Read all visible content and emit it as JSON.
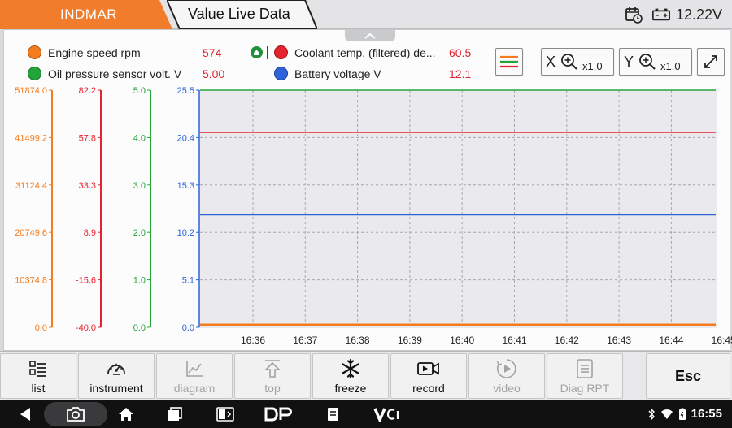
{
  "titlebar": {
    "brand": "INDMAR",
    "page_title": "Value Live Data",
    "voltage": "12.22V",
    "colors": {
      "brand_tab": "#f07c2c"
    }
  },
  "legend": [
    {
      "label": "Engine speed  rpm",
      "value": "574",
      "color": "#f47c1f"
    },
    {
      "label": "Oil pressure sensor volt.  V",
      "value": "5.00",
      "color": "#23a43a"
    },
    {
      "label": "Coolant temp. (filtered)   de...",
      "value": "60.5",
      "color": "#e5232e"
    },
    {
      "label": "Battery voltage  V",
      "value": "12.1",
      "color": "#2f63d9"
    }
  ],
  "zoom": {
    "x_label": "X",
    "x_value": "x1.0",
    "y_label": "Y",
    "y_value": "x1.0"
  },
  "chart_data": {
    "type": "line",
    "x": [
      "16:36",
      "16:37",
      "16:38",
      "16:39",
      "16:40",
      "16:41",
      "16:42",
      "16:43",
      "16:44",
      "16:45"
    ],
    "grid": true,
    "axes": [
      {
        "series": "Engine speed",
        "color": "#f47c1f",
        "ticks": [
          "51874.0",
          "41499.2",
          "31124.4",
          "20749.6",
          "10374.8",
          "0.0"
        ],
        "ylim": [
          0,
          51874
        ]
      },
      {
        "series": "Coolant temp.",
        "color": "#e5232e",
        "ticks": [
          "82.2",
          "57.8",
          "33.3",
          "8.9",
          "-15.6",
          "-40.0"
        ],
        "ylim": [
          -40,
          82.2
        ]
      },
      {
        "series": "Oil pressure",
        "color": "#23a43a",
        "ticks": [
          "5.0",
          "4.0",
          "3.0",
          "2.0",
          "1.0",
          "0.0"
        ],
        "ylim": [
          0,
          5
        ]
      },
      {
        "series": "Battery voltage",
        "color": "#2f63d9",
        "ticks": [
          "25.5",
          "20.4",
          "15.3",
          "10.2",
          "5.1",
          "0.0"
        ],
        "ylim": [
          0,
          25.5
        ]
      }
    ],
    "series": [
      {
        "name": "Engine speed",
        "axis": 0,
        "values": [
          574,
          574,
          574,
          574,
          574,
          574,
          574,
          574,
          574,
          574,
          574
        ]
      },
      {
        "name": "Coolant temp.",
        "axis": 1,
        "values": [
          60.5,
          60.5,
          60.5,
          60.5,
          60.5,
          60.5,
          60.5,
          60.5,
          60.5,
          60.5,
          60.5
        ]
      },
      {
        "name": "Oil pressure",
        "axis": 2,
        "values": [
          5.0,
          5.0,
          5.0,
          5.0,
          5.0,
          5.0,
          5.0,
          5.0,
          5.0,
          5.0,
          5.0
        ]
      },
      {
        "name": "Battery voltage",
        "axis": 3,
        "values": [
          12.1,
          12.1,
          12.1,
          12.1,
          12.1,
          12.1,
          12.1,
          12.1,
          12.1,
          12.1,
          12.1
        ]
      }
    ]
  },
  "toolbar": [
    {
      "key": "list",
      "label": "list",
      "icon": "list-icon",
      "enabled": true
    },
    {
      "key": "instrument",
      "label": "instrument",
      "icon": "gauge-icon",
      "enabled": true
    },
    {
      "key": "diagram",
      "label": "diagram",
      "icon": "line-chart-icon",
      "enabled": false
    },
    {
      "key": "top",
      "label": "top",
      "icon": "arrow-up-icon",
      "enabled": false
    },
    {
      "key": "freeze",
      "label": "freeze",
      "icon": "snowflake-icon",
      "enabled": true
    },
    {
      "key": "record",
      "label": "record",
      "icon": "video-camera-icon",
      "enabled": true
    },
    {
      "key": "video",
      "label": "video",
      "icon": "play-circle-icon",
      "enabled": false
    },
    {
      "key": "diag_rpt",
      "label": "Diag RPT",
      "icon": "report-icon",
      "enabled": false
    },
    {
      "key": "esc",
      "label": "Esc",
      "icon": "",
      "enabled": true
    }
  ],
  "statusbar": {
    "time": "16:55"
  }
}
